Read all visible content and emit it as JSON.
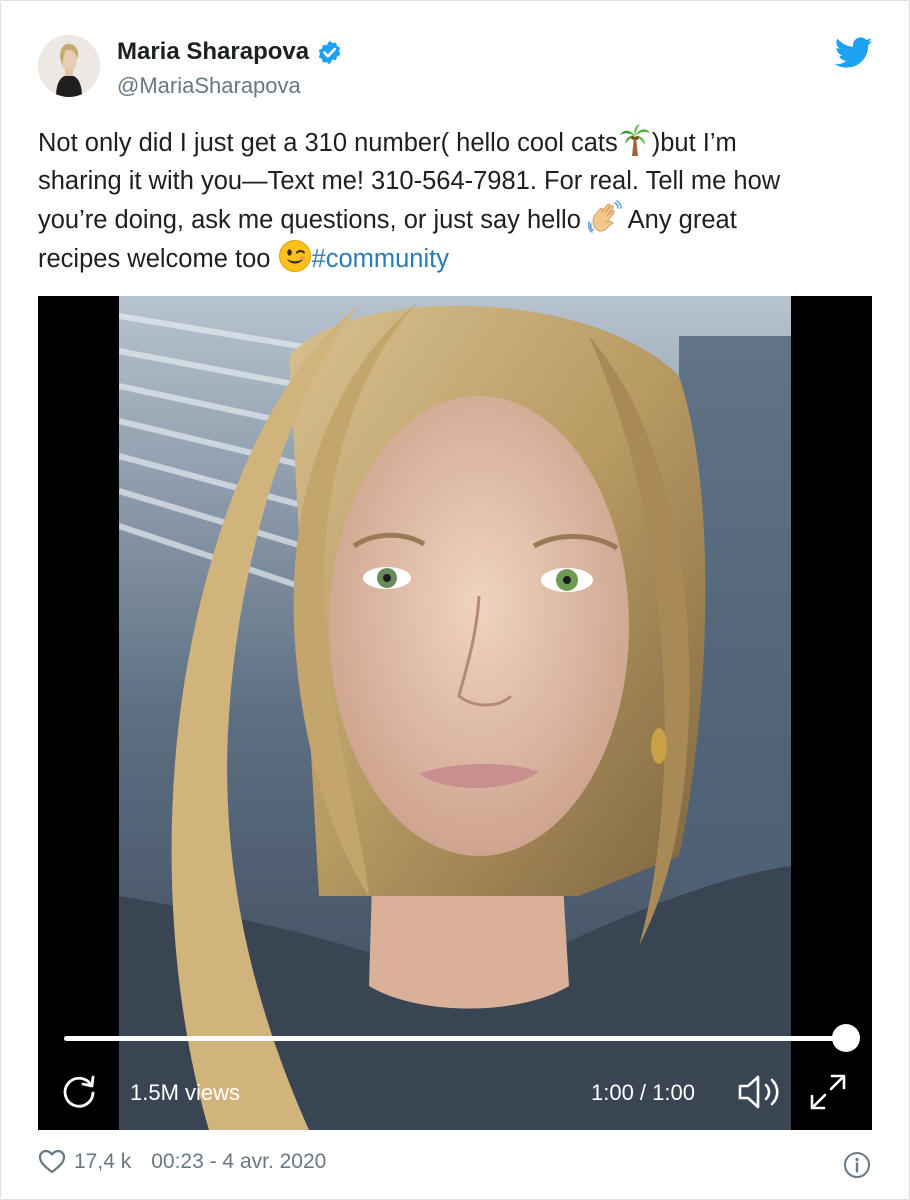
{
  "author": {
    "name": "Maria Sharapova",
    "handle": "@MariaSharapova",
    "verified_icon": "verified-badge-icon",
    "brand_icon": "twitter-bird-icon"
  },
  "tweet": {
    "line1": "Not only did I just get a 310 number( hello cool cats",
    "line1_after": ")but I’m",
    "line2": "sharing it with you—Text me! 310-564-7981. For real. Tell me how",
    "line3": "you’re doing, ask me questions, or just say hello ",
    "line3_after": " Any great",
    "line4": "recipes welcome too ",
    "hashtag": "#community",
    "emoji_1": "palm-tree",
    "emoji_2": "waving-hand",
    "emoji_3": "winking-face"
  },
  "video": {
    "views": "1.5M views",
    "time": "1:00 / 1:00",
    "progress": 1.0,
    "replay_icon": "replay-icon",
    "volume_icon": "volume-icon",
    "fullscreen_icon": "fullscreen-icon"
  },
  "footer": {
    "likes": "17,4 k",
    "timestamp": "00:23 - 4 avr. 2020",
    "heart_icon": "heart-icon",
    "info_icon": "info-icon"
  },
  "colors": {
    "link": "#2b7bb9",
    "twitter_blue": "#1da1f2",
    "secondary_text": "#697882"
  }
}
